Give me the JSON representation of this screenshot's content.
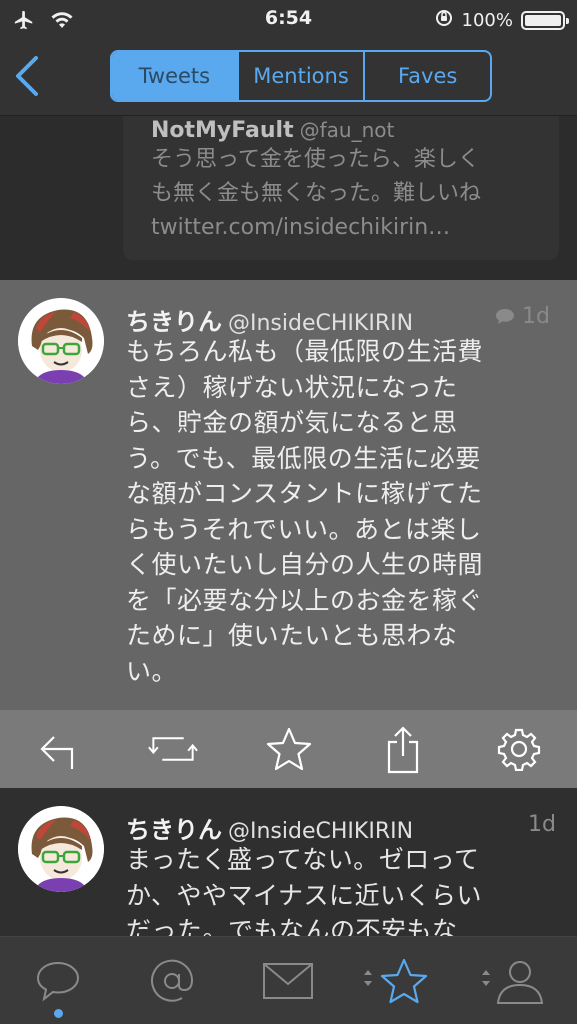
{
  "status_bar": {
    "time": "6:54",
    "battery": "100%"
  },
  "nav": {
    "tabs": [
      {
        "label": "Tweets",
        "active": true
      },
      {
        "label": "Mentions",
        "active": false
      },
      {
        "label": "Faves",
        "active": false
      }
    ]
  },
  "quoted_tweet": {
    "name": "NotMyFault",
    "handle": "@fau_not",
    "lines": [
      "そう思って金を使ったら、楽しく",
      "も無く金も無くなった。難しいね",
      "twitter.com/insidechikirin…"
    ]
  },
  "selected_tweet": {
    "name": "ちきりん",
    "handle": "@InsideCHIKIRIN",
    "time": "1d",
    "lines": [
      "もちろん私も（最低限の生活費",
      "さえ）稼げない状況になった",
      "ら、貯金の額が気になると思",
      "う。でも、最低限の生活に必要",
      "な額がコンスタントに稼げてた",
      "らもうそれでいい。あとは楽し",
      "く使いたいし自分の人生の時間",
      "を「必要な分以上のお金を稼ぐ",
      "ために」使いたいとも思わな",
      "い。"
    ]
  },
  "actions": [
    "reply-icon",
    "retweet-icon",
    "star-icon",
    "share-icon",
    "gear-icon"
  ],
  "next_tweet": {
    "name": "ちきりん",
    "handle": "@InsideCHIKIRIN",
    "time": "1d",
    "lines": [
      "まったく盛ってない。ゼロって",
      "か、ややマイナスに近いくらい",
      "だった。でもなんの不安もな"
    ]
  },
  "tab_bar": {
    "items": [
      "chat-bubble-icon",
      "at-icon",
      "mail-icon",
      "star-icon",
      "person-icon"
    ],
    "active_color": "#5aa9ee"
  }
}
